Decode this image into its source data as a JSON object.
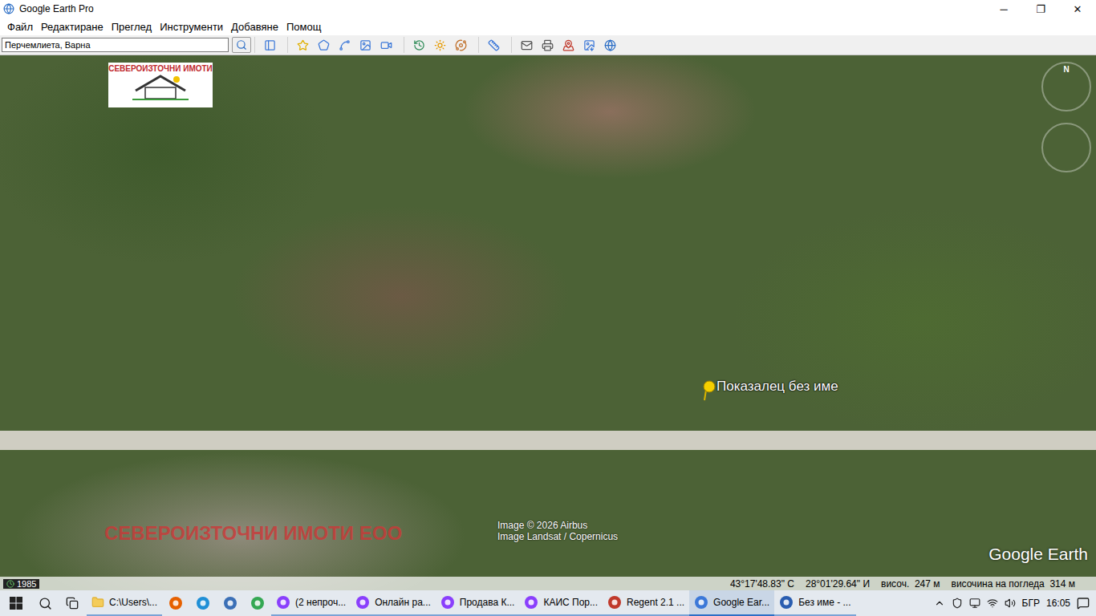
{
  "window": {
    "title": "Google Earth Pro",
    "controls": [
      "─",
      "❐",
      "✕"
    ]
  },
  "menu": [
    "Файл",
    "Редактиране",
    "Преглед",
    "Инструменти",
    "Добавяне",
    "Помощ"
  ],
  "toolbar": {
    "search_value": "Перчемлиета, Варна"
  },
  "map": {
    "logo": "СЕВЕРОИЗТОЧНИ ИМОТИ",
    "compass": "N",
    "placemark": "Показалец без име",
    "watermark": "СЕВЕРОИЗТОЧНИ ИМОТИ ЕОО",
    "attribution": [
      "Image © 2026 Airbus",
      "Image Landsat / Copernicus"
    ],
    "brand": "Google Earth",
    "status": {
      "year": "1985",
      "lat": "43°17'48.83\" С",
      "lon": "28°01'29.64\" И",
      "elevation": "височ.  247 м",
      "eye_alt": "височина на погледа  314 м"
    }
  },
  "taskbar": {
    "items": [
      {
        "label": "C:\\Users\\...",
        "selected": false
      },
      {
        "label": "(2 непроч...",
        "selected": false
      },
      {
        "label": "Онлайн ра...",
        "selected": false
      },
      {
        "label": "Продава К...",
        "selected": false
      },
      {
        "label": "КАИС Пор...",
        "selected": false
      },
      {
        "label": "Regent 2.1 ...",
        "selected": false
      },
      {
        "label": "Google Ear...",
        "selected": true
      },
      {
        "label": "Без име - ...",
        "selected": false
      }
    ],
    "language": "БГР",
    "time": "16:05"
  }
}
